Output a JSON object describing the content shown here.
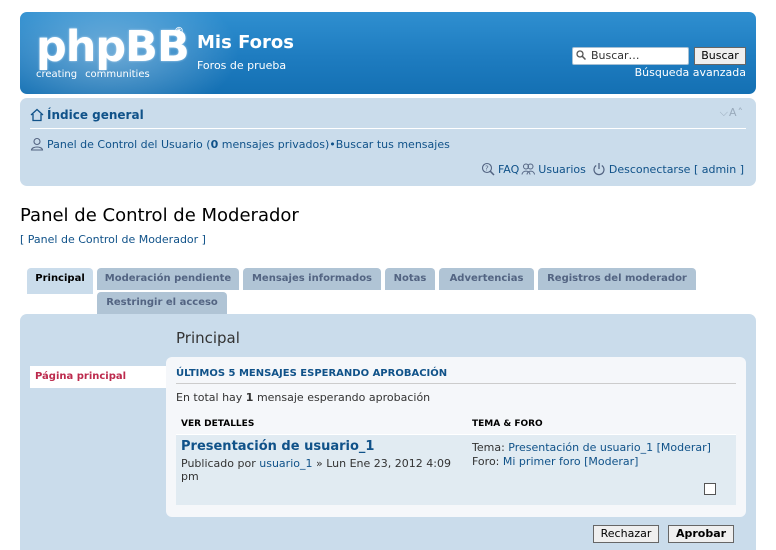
{
  "header": {
    "logo_text": "phpBB",
    "logo_registered": "®",
    "logo_tagline_1": "creating",
    "logo_tagline_2": "communities",
    "site_title": "Mis Foros",
    "site_description": "Foros de prueba",
    "search_placeholder": "Buscar…",
    "search_button": "Buscar",
    "advanced_search": "Búsqueda avanzada"
  },
  "navbar": {
    "index_link": "Índice general",
    "font_size_control": "⌵A˄",
    "ucp_link": "Panel de Control del Usuario (",
    "ucp_count": "0",
    "ucp_suffix": " mensajes privados)",
    "separator": " • ",
    "search_own": "Buscar tus mensajes",
    "faq": "FAQ",
    "members": "Usuarios",
    "logout": "Desconectarse [ admin ]"
  },
  "page": {
    "title": "Panel de Control de Moderador",
    "breadcrumb": "[ Panel de Control de Moderador ]"
  },
  "tabs": [
    {
      "label": "Principal",
      "active": true
    },
    {
      "label": "Moderación pendiente",
      "active": false
    },
    {
      "label": "Mensajes informados",
      "active": false
    },
    {
      "label": "Notas",
      "active": false
    },
    {
      "label": "Advertencias",
      "active": false
    },
    {
      "label": "Registros del moderador",
      "active": false
    },
    {
      "label": "Restringir el acceso",
      "active": false
    }
  ],
  "sidebar": {
    "items": [
      {
        "label": "Página principal",
        "active": true
      }
    ]
  },
  "main": {
    "heading": "Principal",
    "section_title": "ÚLTIMOS 5 MENSAJES ESPERANDO APROBACIÓN",
    "total_prefix": "En total hay ",
    "total_count": "1",
    "total_suffix": " mensaje esperando aprobación",
    "col_details": "VER DETALLES",
    "col_topic_forum": "TEMA & FORO",
    "row": {
      "topic_title": "Presentación de usuario_1",
      "posted_by_prefix": "Publicado por ",
      "author": "usuario_1",
      "posted_date": " » Lun Ene 23, 2012 4:09 pm",
      "topic_label": "Tema: ",
      "topic_link": "Presentación de usuario_1",
      "topic_moderate": "[Moderar]",
      "forum_label": "Foro: ",
      "forum_link": "Mi primer foro",
      "forum_moderate": "[Moderar]"
    },
    "reject_button": "Rechazar",
    "approve_button": "Aprobar"
  }
}
